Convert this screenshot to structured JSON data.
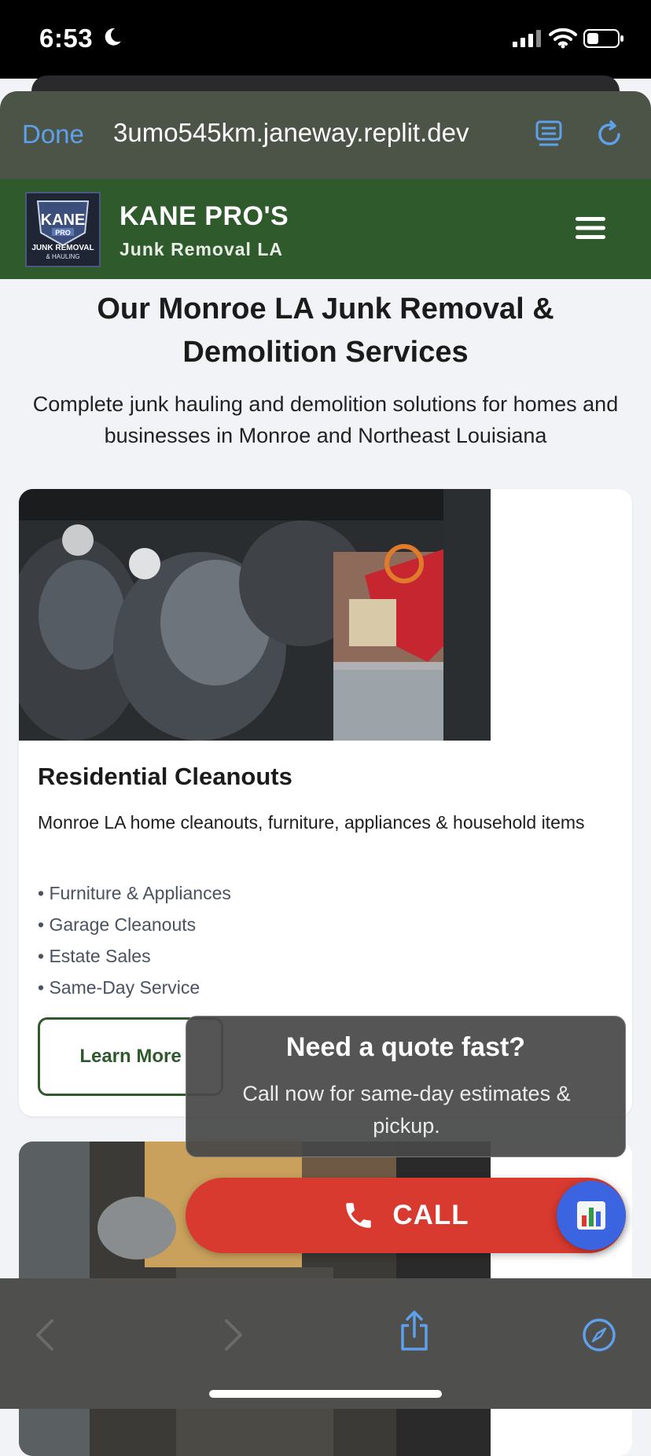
{
  "status_bar": {
    "time": "6:53"
  },
  "browser": {
    "done_label": "Done",
    "url": "3umo545km.janeway.replit.dev"
  },
  "site": {
    "logo_text": [
      "KANE",
      "PRO",
      "JUNK REMOVAL",
      "& HAULING"
    ],
    "brand_name": "KANE PRO'S",
    "brand_sub": "Junk Removal LA"
  },
  "hero": {
    "title": "Our Monroe LA Junk Removal & Demolition Services",
    "subtitle": "Complete junk hauling and demolition solutions for homes and businesses in Monroe and Northeast Louisiana"
  },
  "card": {
    "title": "Residential Cleanouts",
    "description": "Monroe LA home cleanouts, furniture, appliances & household items",
    "features": [
      "Furniture & Appliances",
      "Garage Cleanouts",
      "Estate Sales",
      "Same-Day Service"
    ],
    "button_label": "Learn More"
  },
  "quote_popup": {
    "title": "Need a quote fast?",
    "subtitle": "Call now for same-day estimates & pickup."
  },
  "call_button": {
    "label": "CALL"
  },
  "colors": {
    "brand_green": "#2e5a2c",
    "call_red": "#d83a2f",
    "fab_blue": "#3a64e0",
    "safari_link": "#5fa0ea"
  }
}
